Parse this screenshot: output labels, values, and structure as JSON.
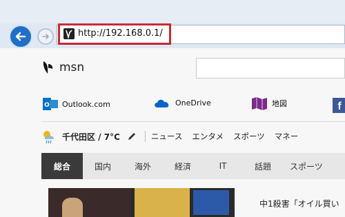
{
  "browser": {
    "back_icon": "arrow-left-icon",
    "forward_icon": "arrow-right-icon",
    "url": "http://192.168.0.1/",
    "accent": "#1f6fc8",
    "highlight_color": "#c82b32"
  },
  "msn": {
    "brand": "msn",
    "icon": "butterfly-icon"
  },
  "shortcuts": [
    {
      "label": "Outlook.com",
      "icon": "outlook-icon",
      "color": "#0072c6"
    },
    {
      "label": "OneDrive",
      "icon": "cloud-icon",
      "color": "#0a64c8"
    },
    {
      "label": "地図",
      "icon": "map-icon",
      "color": "#7a2b8a"
    },
    {
      "label": "f",
      "icon": "facebook-icon",
      "color": "#3b5998"
    }
  ],
  "weather": {
    "location": "千代田区 / 7°C",
    "icon": "weather-sun-rain-icon",
    "edit_icon": "pencil-icon"
  },
  "top_nav": [
    "ニュース",
    "エンタメ",
    "スポーツ",
    "マネー"
  ],
  "categories": [
    "総合",
    "国内",
    "海外",
    "経済",
    "IT",
    "話題",
    "スポーツ"
  ],
  "active_category": "総合",
  "headline": "中1殺害「オイル買い"
}
